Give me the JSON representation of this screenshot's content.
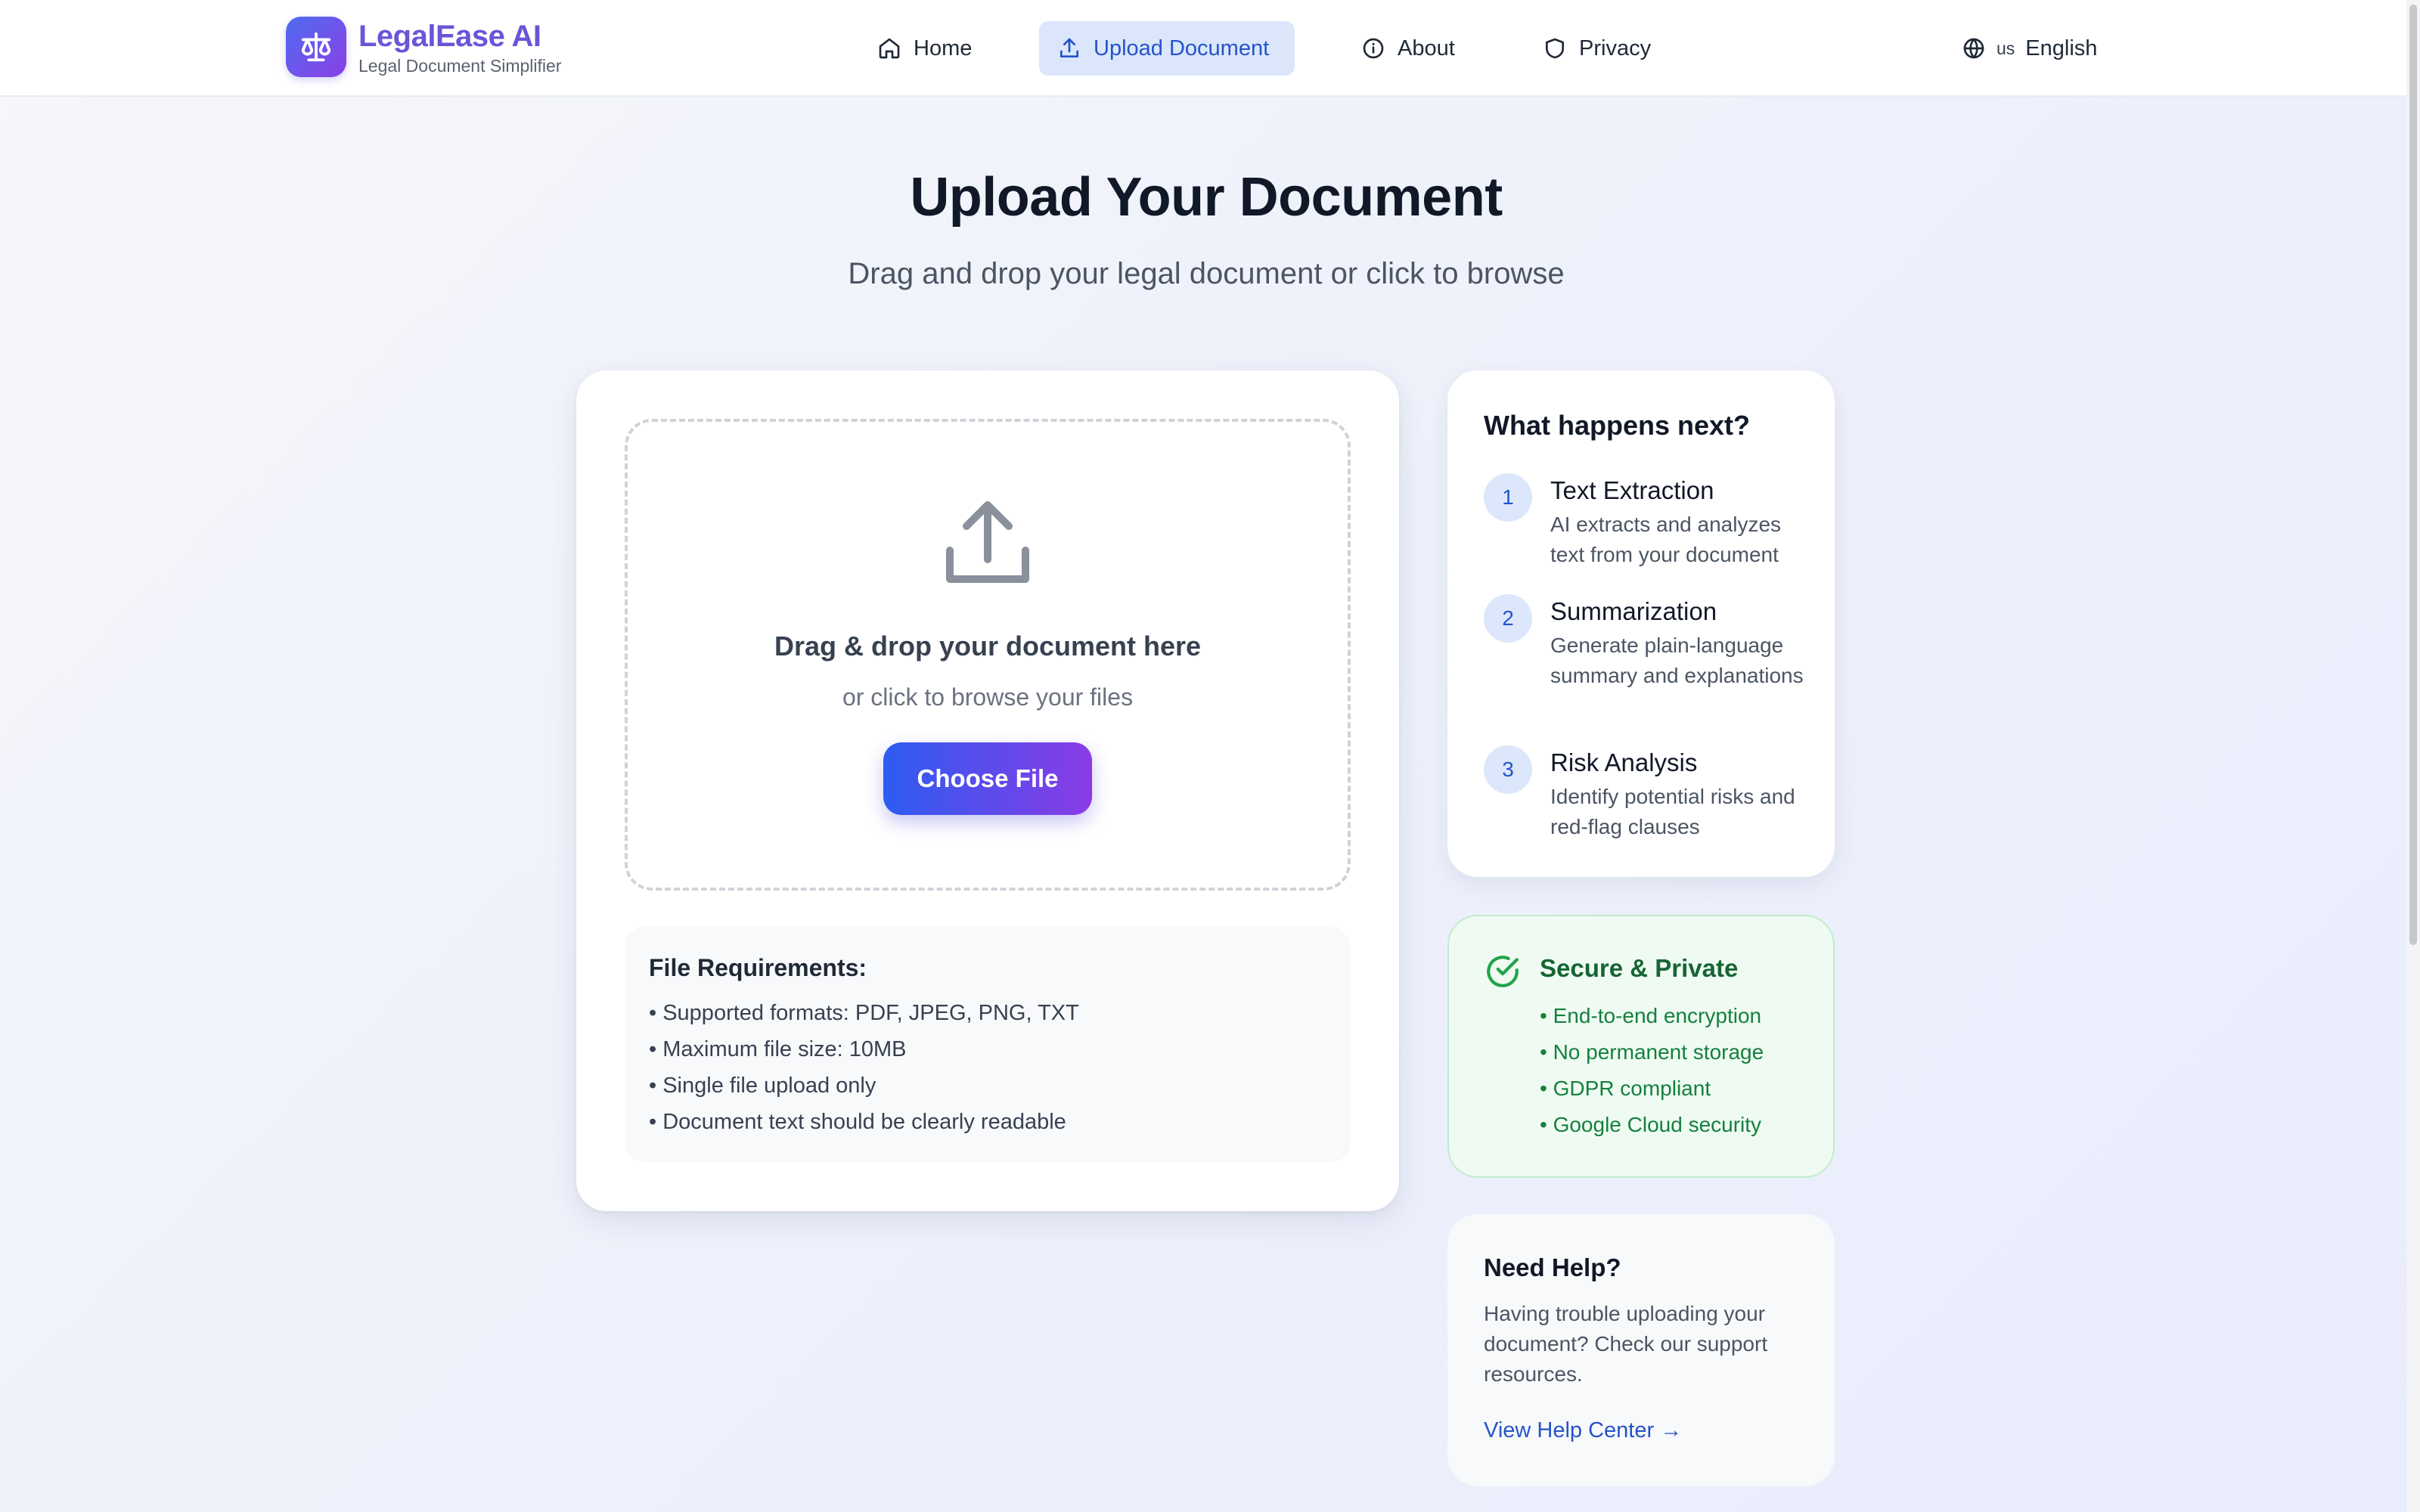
{
  "brand": {
    "name": "LegalEase AI",
    "tagline": "Legal Document Simplifier",
    "icon": "scale-icon"
  },
  "nav": {
    "items": [
      {
        "label": "Home",
        "icon": "home-icon",
        "active": false
      },
      {
        "label": "Upload Document",
        "icon": "upload-icon",
        "active": true
      },
      {
        "label": "About",
        "icon": "info-icon",
        "active": false
      },
      {
        "label": "Privacy",
        "icon": "shield-icon",
        "active": false
      }
    ],
    "language": {
      "code": "us",
      "label": "English",
      "icon": "globe-icon"
    }
  },
  "hero": {
    "title": "Upload Your Document",
    "subtitle": "Drag and drop your legal document or click to browse"
  },
  "dropzone": {
    "title": "Drag & drop your document here",
    "subtitle": "or click to browse your files",
    "button": "Choose File"
  },
  "requirements": {
    "title": "File Requirements:",
    "items": [
      "• Supported formats: PDF, JPEG, PNG, TXT",
      "• Maximum file size: 10MB",
      "• Single file upload only",
      "• Document text should be clearly readable"
    ]
  },
  "next_steps": {
    "title": "What happens next?",
    "steps": [
      {
        "num": "1",
        "title": "Text Extraction",
        "desc": "AI extracts and analyzes text from your document"
      },
      {
        "num": "2",
        "title": "Summarization",
        "desc": "Generate plain-language summary and explanations"
      },
      {
        "num": "3",
        "title": "Risk Analysis",
        "desc": "Identify potential risks and red-flag clauses"
      }
    ]
  },
  "secure": {
    "title": "Secure & Private",
    "items": [
      "• End-to-end encryption",
      "• No permanent storage",
      "• GDPR compliant",
      "• Google Cloud security"
    ]
  },
  "help": {
    "title": "Need Help?",
    "text": "Having trouble uploading your document? Check our support resources.",
    "link": "View Help Center →"
  },
  "colors": {
    "accent": "#2553c9",
    "brand_gradient_start": "#2d5cf0",
    "brand_gradient_end": "#8a3be6",
    "success": "#15803d"
  }
}
